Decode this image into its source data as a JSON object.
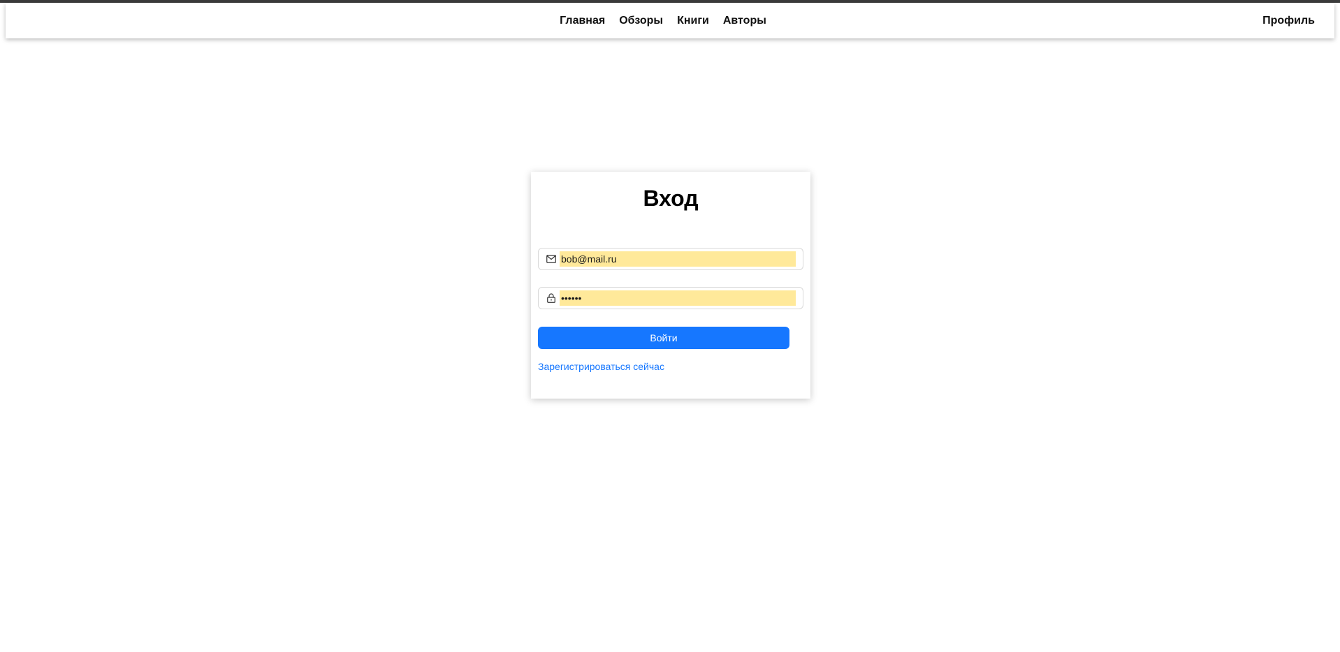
{
  "nav": {
    "links": [
      "Главная",
      "Обзоры",
      "Книги",
      "Авторы"
    ],
    "profile": "Профиль"
  },
  "login": {
    "title": "Вход",
    "email": {
      "icon": "mail-icon",
      "value": "bob@mail.ru"
    },
    "password": {
      "icon": "lock-icon",
      "value": "••••••"
    },
    "submit_label": "Войти",
    "register_link": "Зарегистрироваться сейчас"
  },
  "colors": {
    "accent": "#1677ff",
    "autofill": "#ffe99a",
    "top_strip": "#3b3b3b"
  }
}
